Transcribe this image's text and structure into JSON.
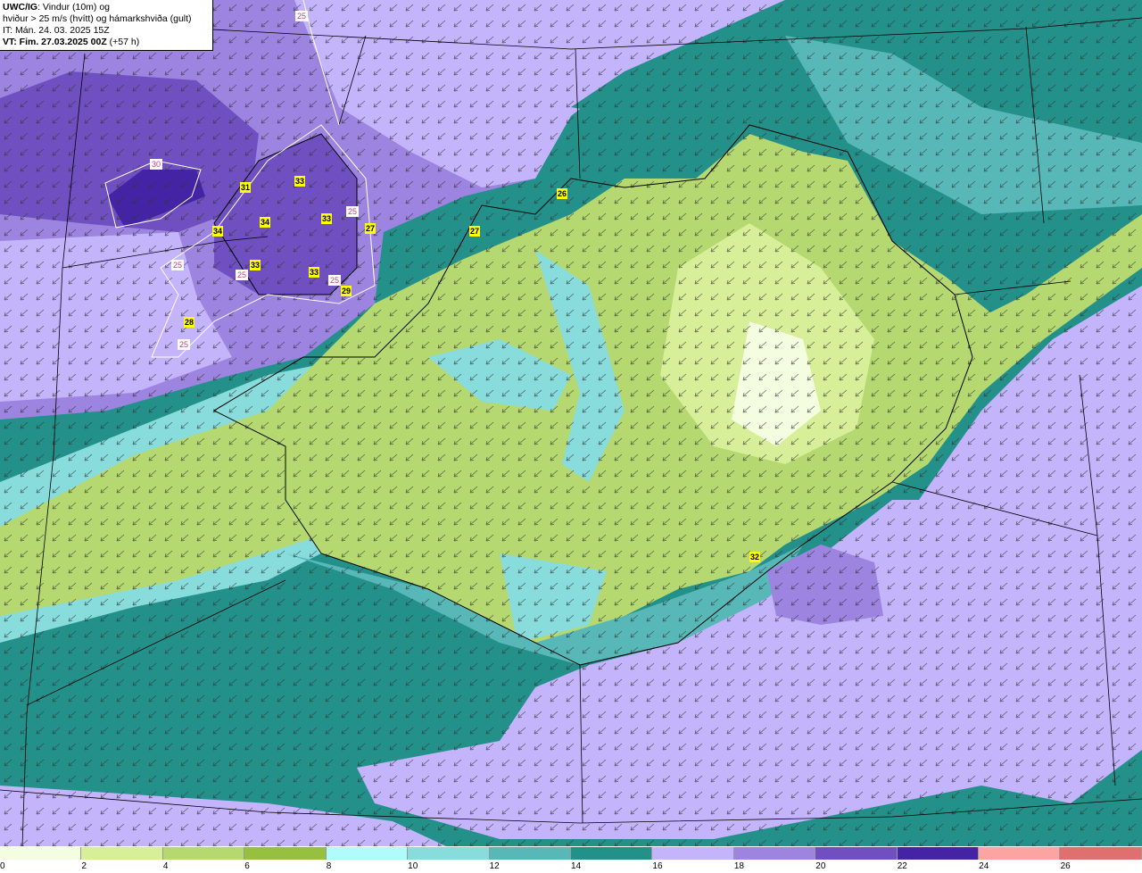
{
  "header": {
    "model": "UWC/IG",
    "line1_rest": ": Vindur (10m) og",
    "line2": "hviður > 25 m/s (hvítt) og hámarkshviða (gult)",
    "line3": "IT: Mán. 24. 03. 2025 15Z",
    "vt_bold": "VT: Fim. 27.03.2025 00Z",
    "vt_rest": " (+57 h)"
  },
  "colorbar": {
    "ticks": [
      "0",
      "2",
      "4",
      "6",
      "8",
      "10",
      "12",
      "14",
      "16",
      "18",
      "20",
      "22",
      "24",
      "26"
    ],
    "colors": [
      "#f4fde0",
      "#d6ef98",
      "#b5d870",
      "#97c040",
      "#b0fcfc",
      "#88dcdc",
      "#58b8b8",
      "#23908a",
      "#c4b4fc",
      "#9c84e0",
      "#7050c0",
      "#4424a4",
      "#fca4a4",
      "#e07070"
    ]
  },
  "max_gust_labels": [
    "31",
    "33",
    "34",
    "33",
    "34",
    "33",
    "33",
    "27",
    "29",
    "26",
    "27",
    "28",
    "32"
  ],
  "gust_contour_labels": [
    "25",
    "30",
    "25",
    "25",
    "25",
    "25",
    "25"
  ],
  "wind_direction": "northeasterly (arrows pointing south-west)"
}
